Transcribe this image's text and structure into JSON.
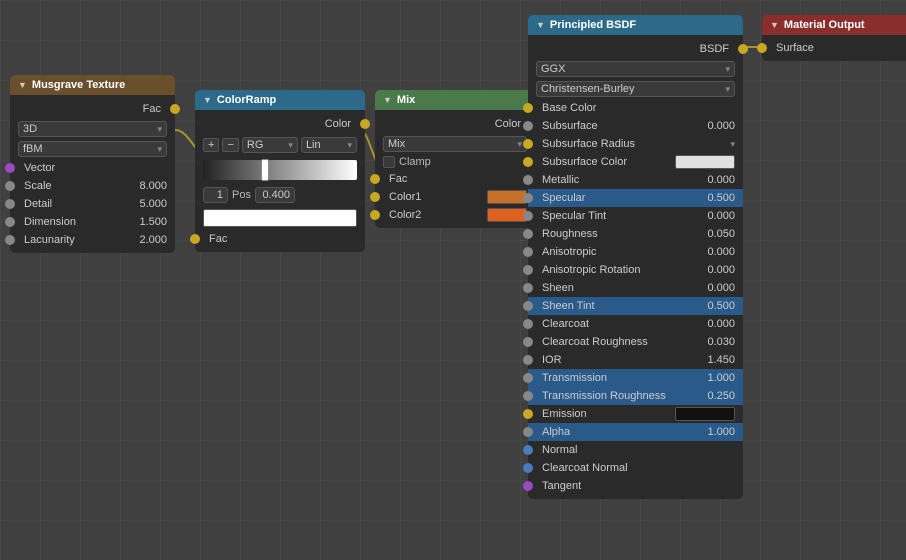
{
  "nodes": {
    "musgrave": {
      "title": "Musgrave Texture",
      "type_dropdown": "3D",
      "subtype_dropdown": "fBM",
      "output_label": "Fac",
      "vector_label": "Vector",
      "fields": [
        {
          "label": "Scale",
          "value": "8.000"
        },
        {
          "label": "Detail",
          "value": "5.000"
        },
        {
          "label": "Dimension",
          "value": "1.500"
        },
        {
          "label": "Lacunarity",
          "value": "2.000"
        }
      ]
    },
    "colorramp": {
      "title": "ColorRamp",
      "output_label": "Color",
      "interpolation": "Lin",
      "color_mode": "RG",
      "slot_num": "1",
      "pos_label": "Pos",
      "pos_value": "0.400",
      "fac_label": "Fac"
    },
    "mix": {
      "title": "Mix",
      "output_label": "Color",
      "blend_mode": "Mix",
      "clamp_label": "Clamp",
      "fac_label": "Fac",
      "color1_label": "Color1",
      "color2_label": "Color2",
      "color1_hex": "#c97028",
      "color2_hex": "#e06020"
    },
    "principled": {
      "title": "Principled BSDF",
      "output_label": "BSDF",
      "distribution": "GGX",
      "subsurface_method": "Christensen-Burley",
      "rows": [
        {
          "label": "Base Color",
          "value": "",
          "type": "color",
          "color": "#ffffff",
          "highlighted": false,
          "connected_in": true
        },
        {
          "label": "Subsurface",
          "value": "0.000",
          "highlighted": false
        },
        {
          "label": "Subsurface Radius",
          "value": "",
          "type": "dropdown",
          "highlighted": false
        },
        {
          "label": "Subsurface Color",
          "value": "",
          "type": "color",
          "color": "#e8e8e8",
          "highlighted": false
        },
        {
          "label": "Metallic",
          "value": "0.000",
          "highlighted": false
        },
        {
          "label": "Specular",
          "value": "0.500",
          "highlighted": true
        },
        {
          "label": "Specular Tint",
          "value": "0.000",
          "highlighted": false
        },
        {
          "label": "Roughness",
          "value": "0.050",
          "highlighted": false
        },
        {
          "label": "Anisotropic",
          "value": "0.000",
          "highlighted": false
        },
        {
          "label": "Anisotropic Rotation",
          "value": "0.000",
          "highlighted": false
        },
        {
          "label": "Sheen",
          "value": "0.000",
          "highlighted": false
        },
        {
          "label": "Sheen Tint",
          "value": "0.500",
          "highlighted": true
        },
        {
          "label": "Clearcoat",
          "value": "0.000",
          "highlighted": false
        },
        {
          "label": "Clearcoat Roughness",
          "value": "0.030",
          "highlighted": false
        },
        {
          "label": "IOR",
          "value": "1.450",
          "highlighted": false
        },
        {
          "label": "Transmission",
          "value": "1.000",
          "highlighted": true
        },
        {
          "label": "Transmission Roughness",
          "value": "0.250",
          "highlighted": true
        },
        {
          "label": "Emission",
          "value": "",
          "type": "color",
          "color": "#111111",
          "highlighted": false
        },
        {
          "label": "Alpha",
          "value": "1.000",
          "highlighted": true
        },
        {
          "label": "Normal",
          "value": "",
          "highlighted": false
        },
        {
          "label": "Clearcoat Normal",
          "value": "",
          "highlighted": false
        },
        {
          "label": "Tangent",
          "value": "",
          "highlighted": false
        }
      ]
    },
    "matoutput": {
      "title": "Material Output",
      "surface_label": "Surface"
    }
  },
  "icons": {
    "collapse": "▼",
    "dropdown_arrow": "▾",
    "plus": "+",
    "minus": "−"
  }
}
